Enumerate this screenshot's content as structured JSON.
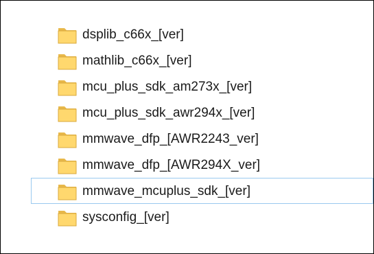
{
  "explorer": {
    "folders": [
      {
        "name": "dsplib_c66x_[ver]",
        "icon": "folder-icon",
        "selected": false
      },
      {
        "name": "mathlib_c66x_[ver]",
        "icon": "folder-icon",
        "selected": false
      },
      {
        "name": "mcu_plus_sdk_am273x_[ver]",
        "icon": "folder-icon",
        "selected": false
      },
      {
        "name": "mcu_plus_sdk_awr294x_[ver]",
        "icon": "folder-icon",
        "selected": false
      },
      {
        "name": "mmwave_dfp_[AWR2243_ver]",
        "icon": "folder-icon",
        "selected": false
      },
      {
        "name": "mmwave_dfp_[AWR294X_ver]",
        "icon": "folder-icon",
        "selected": false
      },
      {
        "name": "mmwave_mcuplus_sdk_[ver]",
        "icon": "folder-icon",
        "selected": true
      },
      {
        "name": "sysconfig_[ver]",
        "icon": "folder-icon",
        "selected": false
      }
    ],
    "colors": {
      "folder_body": "#ffd86e",
      "folder_back": "#e8b84a",
      "folder_edge": "#d9a93c",
      "selection_border": "#99c9ef"
    }
  }
}
